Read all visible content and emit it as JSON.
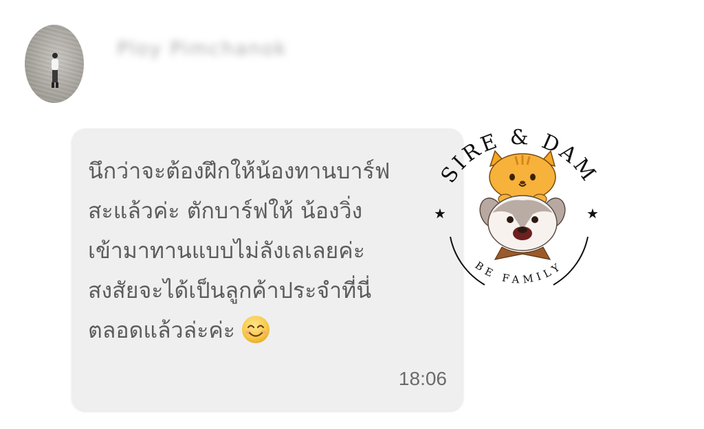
{
  "chat": {
    "sender_name": "Ploy Pimchanok",
    "message": {
      "lines": [
        "นึกว่าจะต้องฝึกให้น้องทานบาร์ฟ",
        "สะแล้วค่ะ ตักบาร์ฟให้ น้องวิ่ง",
        "เข้ามาทานแบบไม่ลังเลเลยค่ะ",
        "สงสัยจะได้เป็นลูกค้าประจำที่นี่",
        "ตลอดแล้วล่ะค่ะ"
      ],
      "emoji": "smiling-face-icon",
      "time": "18:06"
    }
  },
  "logo": {
    "top_text": "SIRE & DAM",
    "bottom_text": "BE FAMILY",
    "star": "★"
  }
}
